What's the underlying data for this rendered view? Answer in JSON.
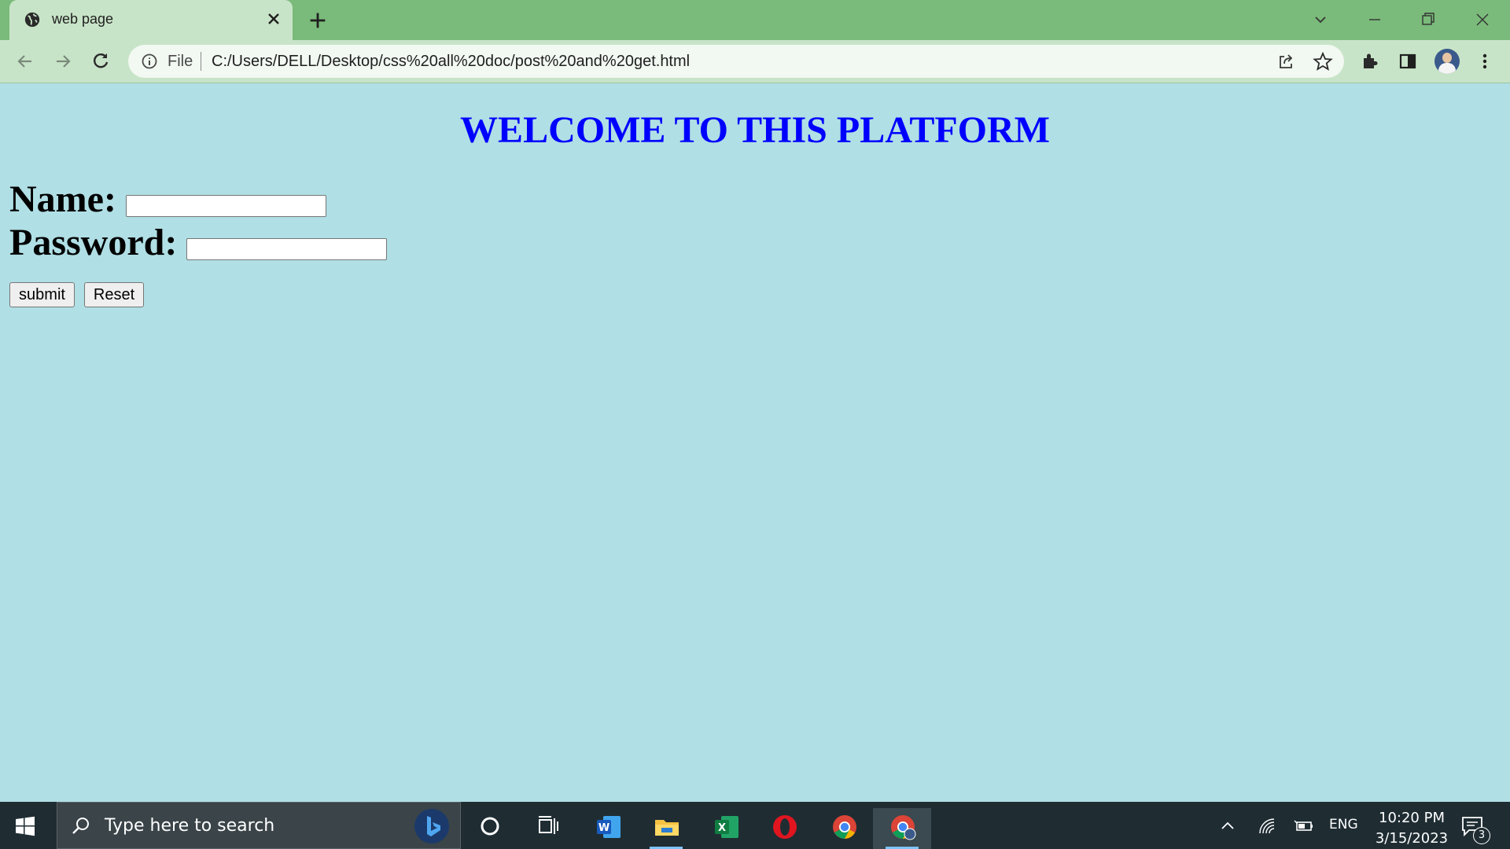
{
  "browser": {
    "tab": {
      "title": "web page",
      "icon": "globe-icon"
    },
    "address_bar": {
      "scheme_label": "File",
      "url": "C:/Users/DELL/Desktop/css%20all%20doc/post%20and%20get.html"
    },
    "colors": {
      "titlebar": "#7aba7a",
      "toolbar": "#c8e4c8"
    }
  },
  "page": {
    "heading": "WELCOME TO THIS PLATFORM",
    "form": {
      "name_label": "Name:",
      "name_value": "",
      "password_label": "Password:",
      "password_value": "",
      "submit_label": "submit",
      "reset_label": "Reset"
    },
    "colors": {
      "background": "#b0dfe5",
      "heading": "#0000ff"
    }
  },
  "taskbar": {
    "search_placeholder": "Type here to search",
    "apps": [
      "cortana-icon",
      "task-view-icon",
      "word-icon",
      "file-explorer-icon",
      "excel-icon",
      "opera-icon",
      "chrome-icon",
      "chrome-profile-icon"
    ],
    "tray": {
      "language": "ENG",
      "time": "10:20 PM",
      "date": "3/15/2023",
      "notification_count": "3"
    }
  }
}
